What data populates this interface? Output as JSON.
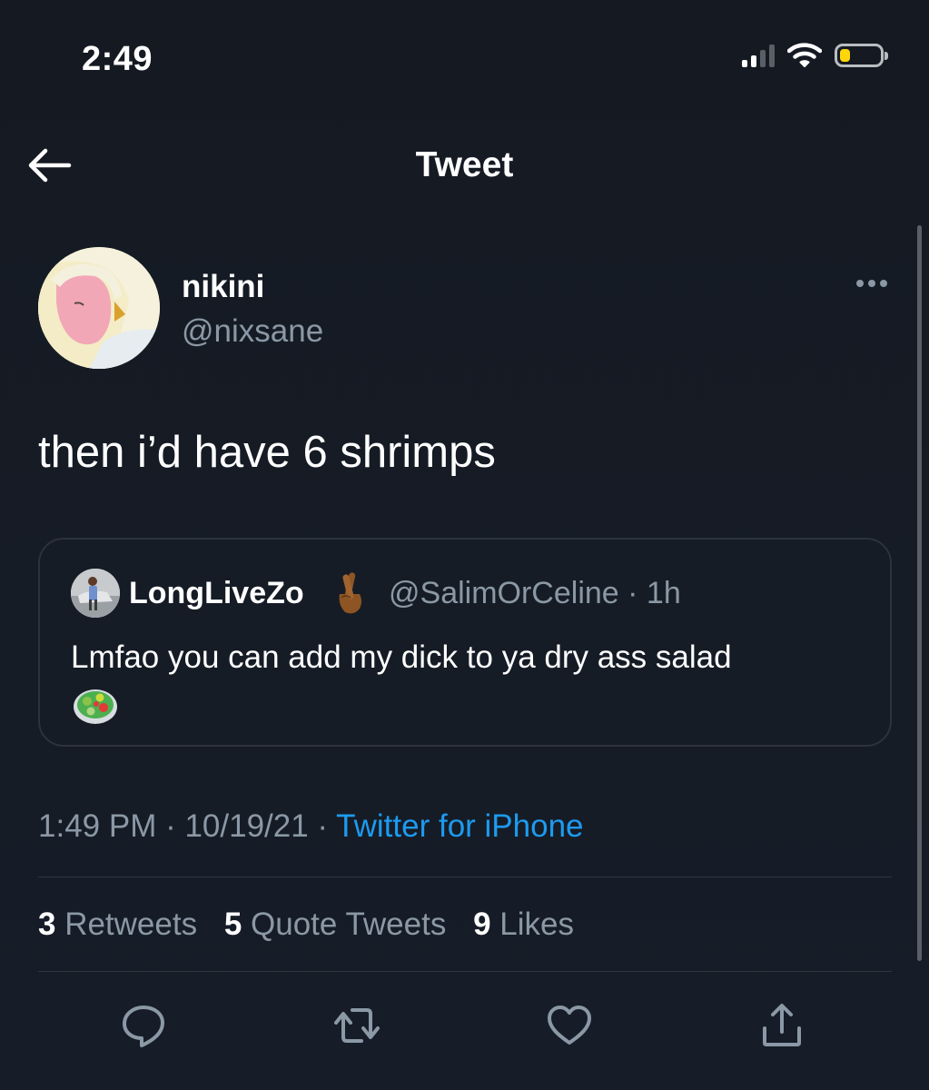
{
  "status_bar": {
    "time": "2:49",
    "battery_level": 0.25,
    "signal_bars_active": 2,
    "signal_bars_total": 4
  },
  "nav": {
    "title": "Tweet",
    "back_icon": "arrow-left-icon"
  },
  "tweet": {
    "author_name": "nikini",
    "author_handle": "@nixsane",
    "text": "then i’d have 6 shrimps",
    "timestamp": "1:49 PM · 10/19/21 · ",
    "source": "Twitter for iPhone"
  },
  "quote": {
    "author_name": "LongLiveZo",
    "author_emoji": "crossed-fingers-emoji",
    "meta": "@SalimOrCeline · 1h",
    "text": "Lmfao you can add my dick to ya dry ass salad",
    "trailing_emoji": "salad-emoji"
  },
  "stats": {
    "retweets_count": "3",
    "retweets_label": " Retweets",
    "quotes_count": "5",
    "quotes_label": " Quote Tweets",
    "likes_count": "9",
    "likes_label": " Likes"
  },
  "actions": [
    "reply-icon",
    "retweet-icon",
    "like-icon",
    "share-icon"
  ],
  "colors": {
    "background": "#161d28",
    "link": "#1d9bf0",
    "secondary_text": "#8b98a5",
    "battery": "#ffd60a"
  }
}
